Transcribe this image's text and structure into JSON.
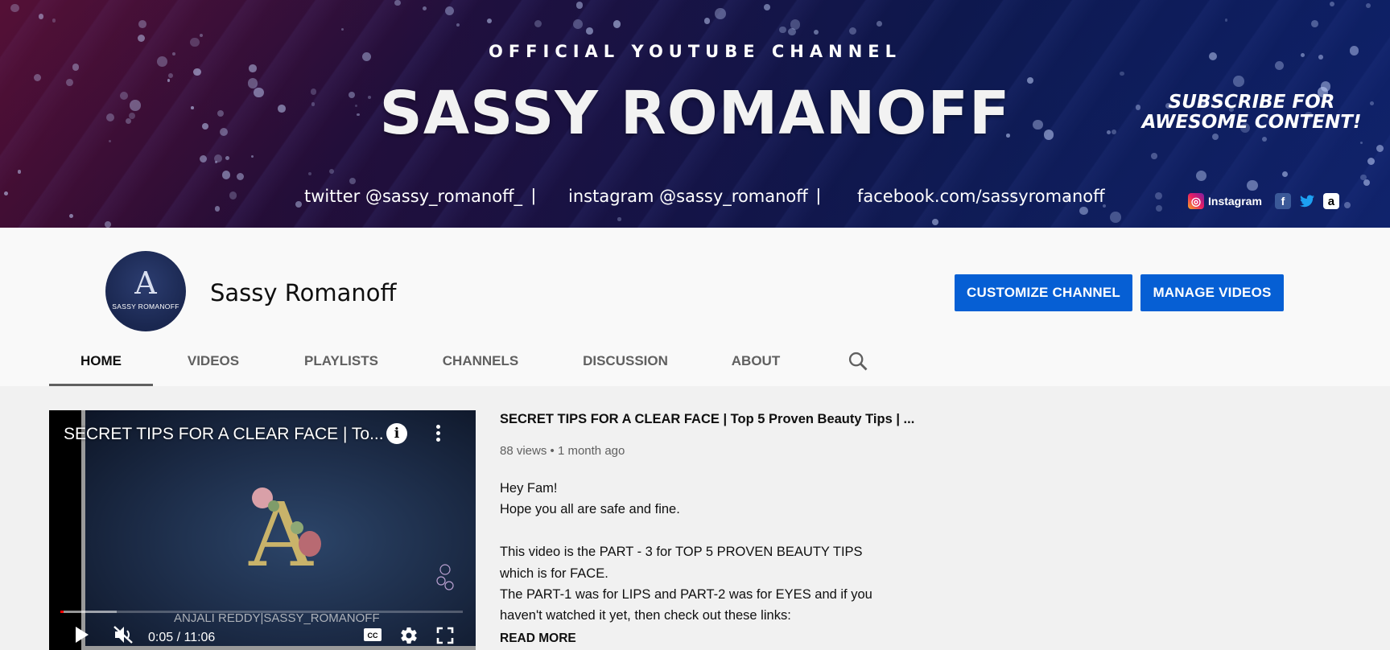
{
  "banner": {
    "subtitle": "OFFICIAL YOUTUBE CHANNEL",
    "brand": "SASSY ROMANOFF",
    "twitter": "twitter @sassy_romanoff_",
    "instagram": "instagram @sassy_romanoff",
    "facebook": "facebook.com/sassyromanoff",
    "separator": "|",
    "promo": "SUBSCRIBE FOR AWESOME CONTENT!",
    "links": {
      "instagram_label": "Instagram",
      "facebook_glyph": "f",
      "twitter_glyph": "🐦",
      "amazon_glyph": "a",
      "icons": [
        "instagram-icon",
        "facebook-icon",
        "twitter-icon",
        "amazon-icon"
      ]
    }
  },
  "channel": {
    "avatar_monogram": "A",
    "avatar_text": "SASSY ROMANOFF",
    "name": "Sassy Romanoff",
    "customize_label": "CUSTOMIZE CHANNEL",
    "manage_label": "MANAGE VIDEOS"
  },
  "tabs": [
    {
      "label": "HOME",
      "active": true
    },
    {
      "label": "VIDEOS",
      "active": false
    },
    {
      "label": "PLAYLISTS",
      "active": false
    },
    {
      "label": "CHANNELS",
      "active": false
    },
    {
      "label": "DISCUSSION",
      "active": false
    },
    {
      "label": "ABOUT",
      "active": false
    }
  ],
  "player": {
    "title": "SECRET TIPS FOR A CLEAR FACE | To...",
    "info_glyph": "i",
    "monogram": "A",
    "watermark": "ANJALI REDDY|SASSY_ROMANOFF",
    "time": "0:05 / 11:06",
    "played_fraction": 0.008,
    "loaded_fraction": 0.14,
    "cc_label": "CC"
  },
  "featured": {
    "title": "SECRET TIPS FOR A CLEAR FACE | Top 5 Proven Beauty Tips | ...",
    "meta": "88 views • 1 month ago",
    "description": [
      "Hey Fam!",
      "Hope you all are safe and fine.",
      "",
      "This video is the PART - 3 for TOP 5 PROVEN BEAUTY TIPS",
      "which is for FACE.",
      "The PART-1 was for LIPS and PART-2 was for EYES and if you",
      "haven't watched it yet, then check out these links:"
    ],
    "read_more": "READ MORE"
  },
  "colors": {
    "accent": "#065fd4",
    "progress": "#ff0000"
  }
}
